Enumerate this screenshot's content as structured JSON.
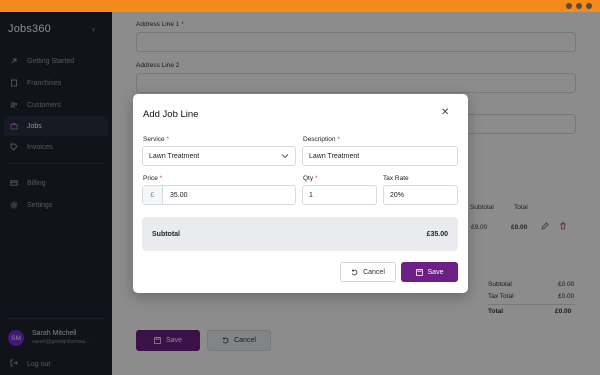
{
  "app": {
    "brand": "Jobs360",
    "collapse_icon": "chevron-left-icon"
  },
  "sidebar": {
    "items": [
      {
        "label": "Getting Started",
        "icon": "rocket-icon"
      },
      {
        "label": "Franchises",
        "icon": "building-icon"
      },
      {
        "label": "Customers",
        "icon": "users-icon"
      },
      {
        "label": "Jobs",
        "icon": "briefcase-icon",
        "active": true
      },
      {
        "label": "Invoices",
        "icon": "tag-icon"
      },
      {
        "label": "Billing",
        "icon": "card-icon"
      },
      {
        "label": "Settings",
        "icon": "gear-icon"
      }
    ],
    "user": {
      "initials": "SM",
      "name": "Sarah Mitchell",
      "email": "sarah@greatjobsmaa..."
    },
    "logout_label": "Log out"
  },
  "form": {
    "address_line_1": "Address Line 1",
    "address_line_2": "Address Line 2",
    "table_headers": {
      "subtotal": "Subtotal",
      "total": "Total"
    },
    "line_values": {
      "subtotal": "£9.00",
      "total": "£0.00"
    },
    "summary": {
      "subtotal_label": "Subtotal",
      "subtotal_value": "£0.00",
      "tax_label": "Tax Total",
      "tax_value": "£0.00",
      "total_label": "Total",
      "total_value": "£0.00"
    },
    "save_label": "Save",
    "cancel_label": "Cancel"
  },
  "modal": {
    "title": "Add Job Line",
    "fields": {
      "service_label": "Service",
      "service_value": "Lawn Treatment",
      "description_label": "Description",
      "description_value": "Lawn Treatment",
      "price_label": "Price",
      "price_prefix": "£",
      "price_value": "35.00",
      "qty_label": "Qty",
      "qty_value": "1",
      "tax_rate_label": "Tax Rate",
      "tax_rate_value": "20%"
    },
    "subtotal_label": "Subtotal",
    "subtotal_value": "£35.00",
    "cancel_label": "Cancel",
    "save_label": "Save"
  },
  "colors": {
    "accent": "#6c1f85",
    "chrome": "#f28a1c",
    "sidebar": "#1f2430",
    "required": "#d43c3c"
  }
}
